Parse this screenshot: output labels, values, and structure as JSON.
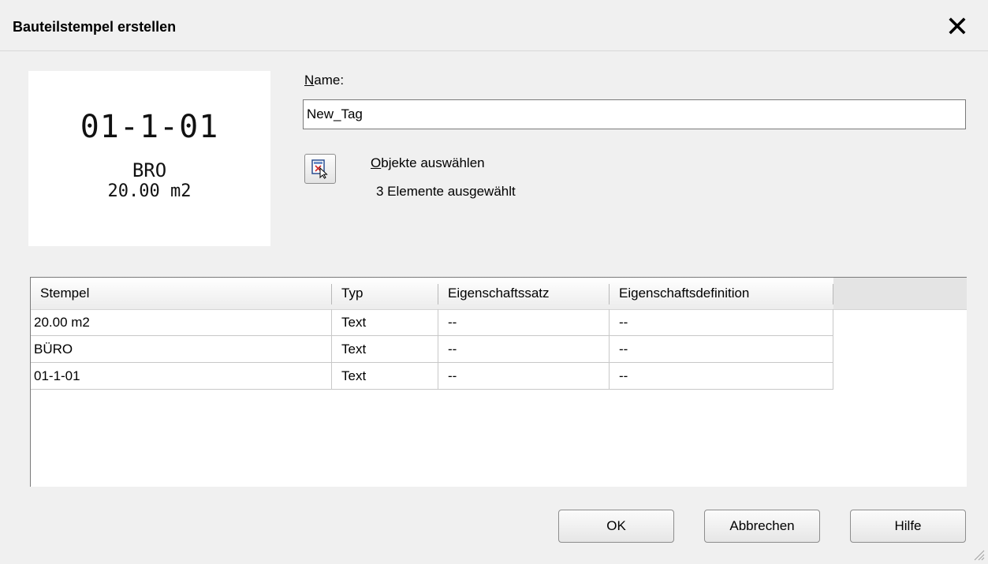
{
  "window": {
    "title": "Bauteilstempel erstellen"
  },
  "preview": {
    "line1": "01-1-01",
    "line2": "BRO",
    "line3": "20.00 m2"
  },
  "name_field": {
    "label_underlined": "N",
    "label_rest": "ame:",
    "value": "New_Tag"
  },
  "select_objects": {
    "label_underlined": "O",
    "label_rest": "bjekte auswählen",
    "status": "3 Elemente ausgewählt",
    "icon": "select-objects-icon"
  },
  "table": {
    "columns": [
      "Stempel",
      "Typ",
      "Eigenschaftssatz",
      "Eigenschaftsdefinition"
    ],
    "rows": [
      [
        "20.00 m2",
        "Text",
        "--",
        "--"
      ],
      [
        "BÜRO",
        "Text",
        "--",
        "--"
      ],
      [
        "01-1-01",
        "Text",
        "--",
        "--"
      ]
    ]
  },
  "buttons": {
    "ok": "OK",
    "cancel": "Abbrechen",
    "help": "Hilfe"
  },
  "colors": {
    "background": "#f0f0f0",
    "list_bg": "#ffffff"
  }
}
